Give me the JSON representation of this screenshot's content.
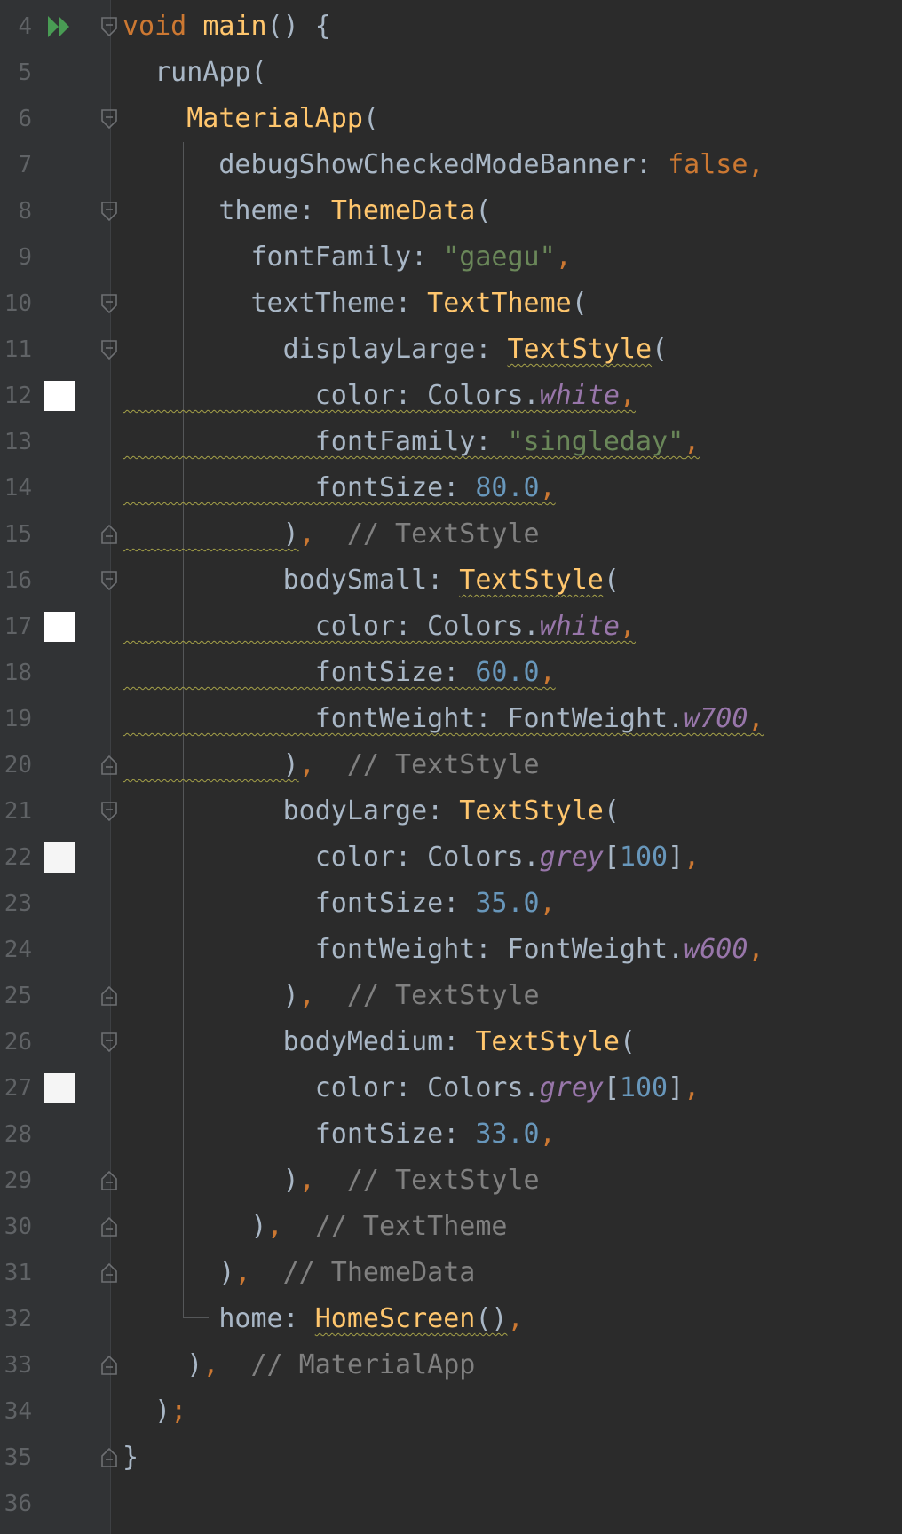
{
  "editor": {
    "line_numbers": [
      "4",
      "5",
      "6",
      "7",
      "8",
      "9",
      "10",
      "11",
      "12",
      "13",
      "14",
      "15",
      "16",
      "17",
      "18",
      "19",
      "20",
      "21",
      "22",
      "23",
      "24",
      "25",
      "26",
      "27",
      "28",
      "29",
      "30",
      "31",
      "32",
      "33",
      "34",
      "35",
      "36"
    ],
    "colors": {
      "background": "#2b2b2b",
      "gutter": "#313335",
      "keyword": "#cc7832",
      "function": "#ffc66d",
      "string": "#6a8759",
      "number": "#6897bb",
      "field": "#9876aa",
      "comment": "#808080",
      "text": "#a9b7c6"
    },
    "swatch_colors": {
      "white": "#ffffff",
      "grey100": "#f5f5f5"
    },
    "icons": {
      "run": "run-gutter-icon",
      "fold": "fold-marker-icon",
      "swatch": "color-swatch-icon"
    },
    "lines": {
      "l4": [
        "void",
        " ",
        "main",
        "() {"
      ],
      "l5": [
        "  runApp("
      ],
      "l6": [
        "    ",
        "MaterialApp",
        "("
      ],
      "l7": [
        "      debugShowCheckedModeBanner: ",
        "false",
        ","
      ],
      "l8": [
        "      theme: ",
        "ThemeData",
        "("
      ],
      "l9": [
        "        fontFamily: ",
        "\"gaegu\"",
        ","
      ],
      "l10": [
        "        textTheme: ",
        "TextTheme",
        "("
      ],
      "l11": [
        "          displayLarge: ",
        "TextStyle",
        "("
      ],
      "l12": [
        "            color: Colors.",
        "white",
        ","
      ],
      "l13": [
        "            fontFamily: ",
        "\"singleday\"",
        ","
      ],
      "l14": [
        "            fontSize: ",
        "80.0",
        ","
      ],
      "l15": [
        "          )",
        ",",
        "  // TextStyle"
      ],
      "l16": [
        "          bodySmall: ",
        "TextStyle",
        "("
      ],
      "l17": [
        "            color: Colors.",
        "white",
        ","
      ],
      "l18": [
        "            fontSize: ",
        "60.0",
        ","
      ],
      "l19": [
        "            fontWeight: FontWeight.",
        "w700",
        ","
      ],
      "l20": [
        "          )",
        ",",
        "  // TextStyle"
      ],
      "l21": [
        "          bodyLarge: ",
        "TextStyle",
        "("
      ],
      "l22": [
        "            color: Colors.",
        "grey",
        "[",
        "100",
        "]",
        ","
      ],
      "l23": [
        "            fontSize: ",
        "35.0",
        ","
      ],
      "l24": [
        "            fontWeight: FontWeight.",
        "w600",
        ","
      ],
      "l25": [
        "          )",
        ",",
        "  // TextStyle"
      ],
      "l26": [
        "          bodyMedium: ",
        "TextStyle",
        "("
      ],
      "l27": [
        "            color: Colors.",
        "grey",
        "[",
        "100",
        "]",
        ","
      ],
      "l28": [
        "            fontSize: ",
        "33.0",
        ","
      ],
      "l29": [
        "          )",
        ",",
        "  // TextStyle"
      ],
      "l30": [
        "        )",
        ",",
        "  // TextTheme"
      ],
      "l31": [
        "      )",
        ",",
        "  // ThemeData"
      ],
      "l32": [
        "      home: ",
        "HomeScreen",
        "()",
        ","
      ],
      "l33": [
        "    )",
        ",",
        "  // MaterialApp"
      ],
      "l34": [
        "  )",
        ";"
      ],
      "l35": [
        "}"
      ]
    }
  }
}
